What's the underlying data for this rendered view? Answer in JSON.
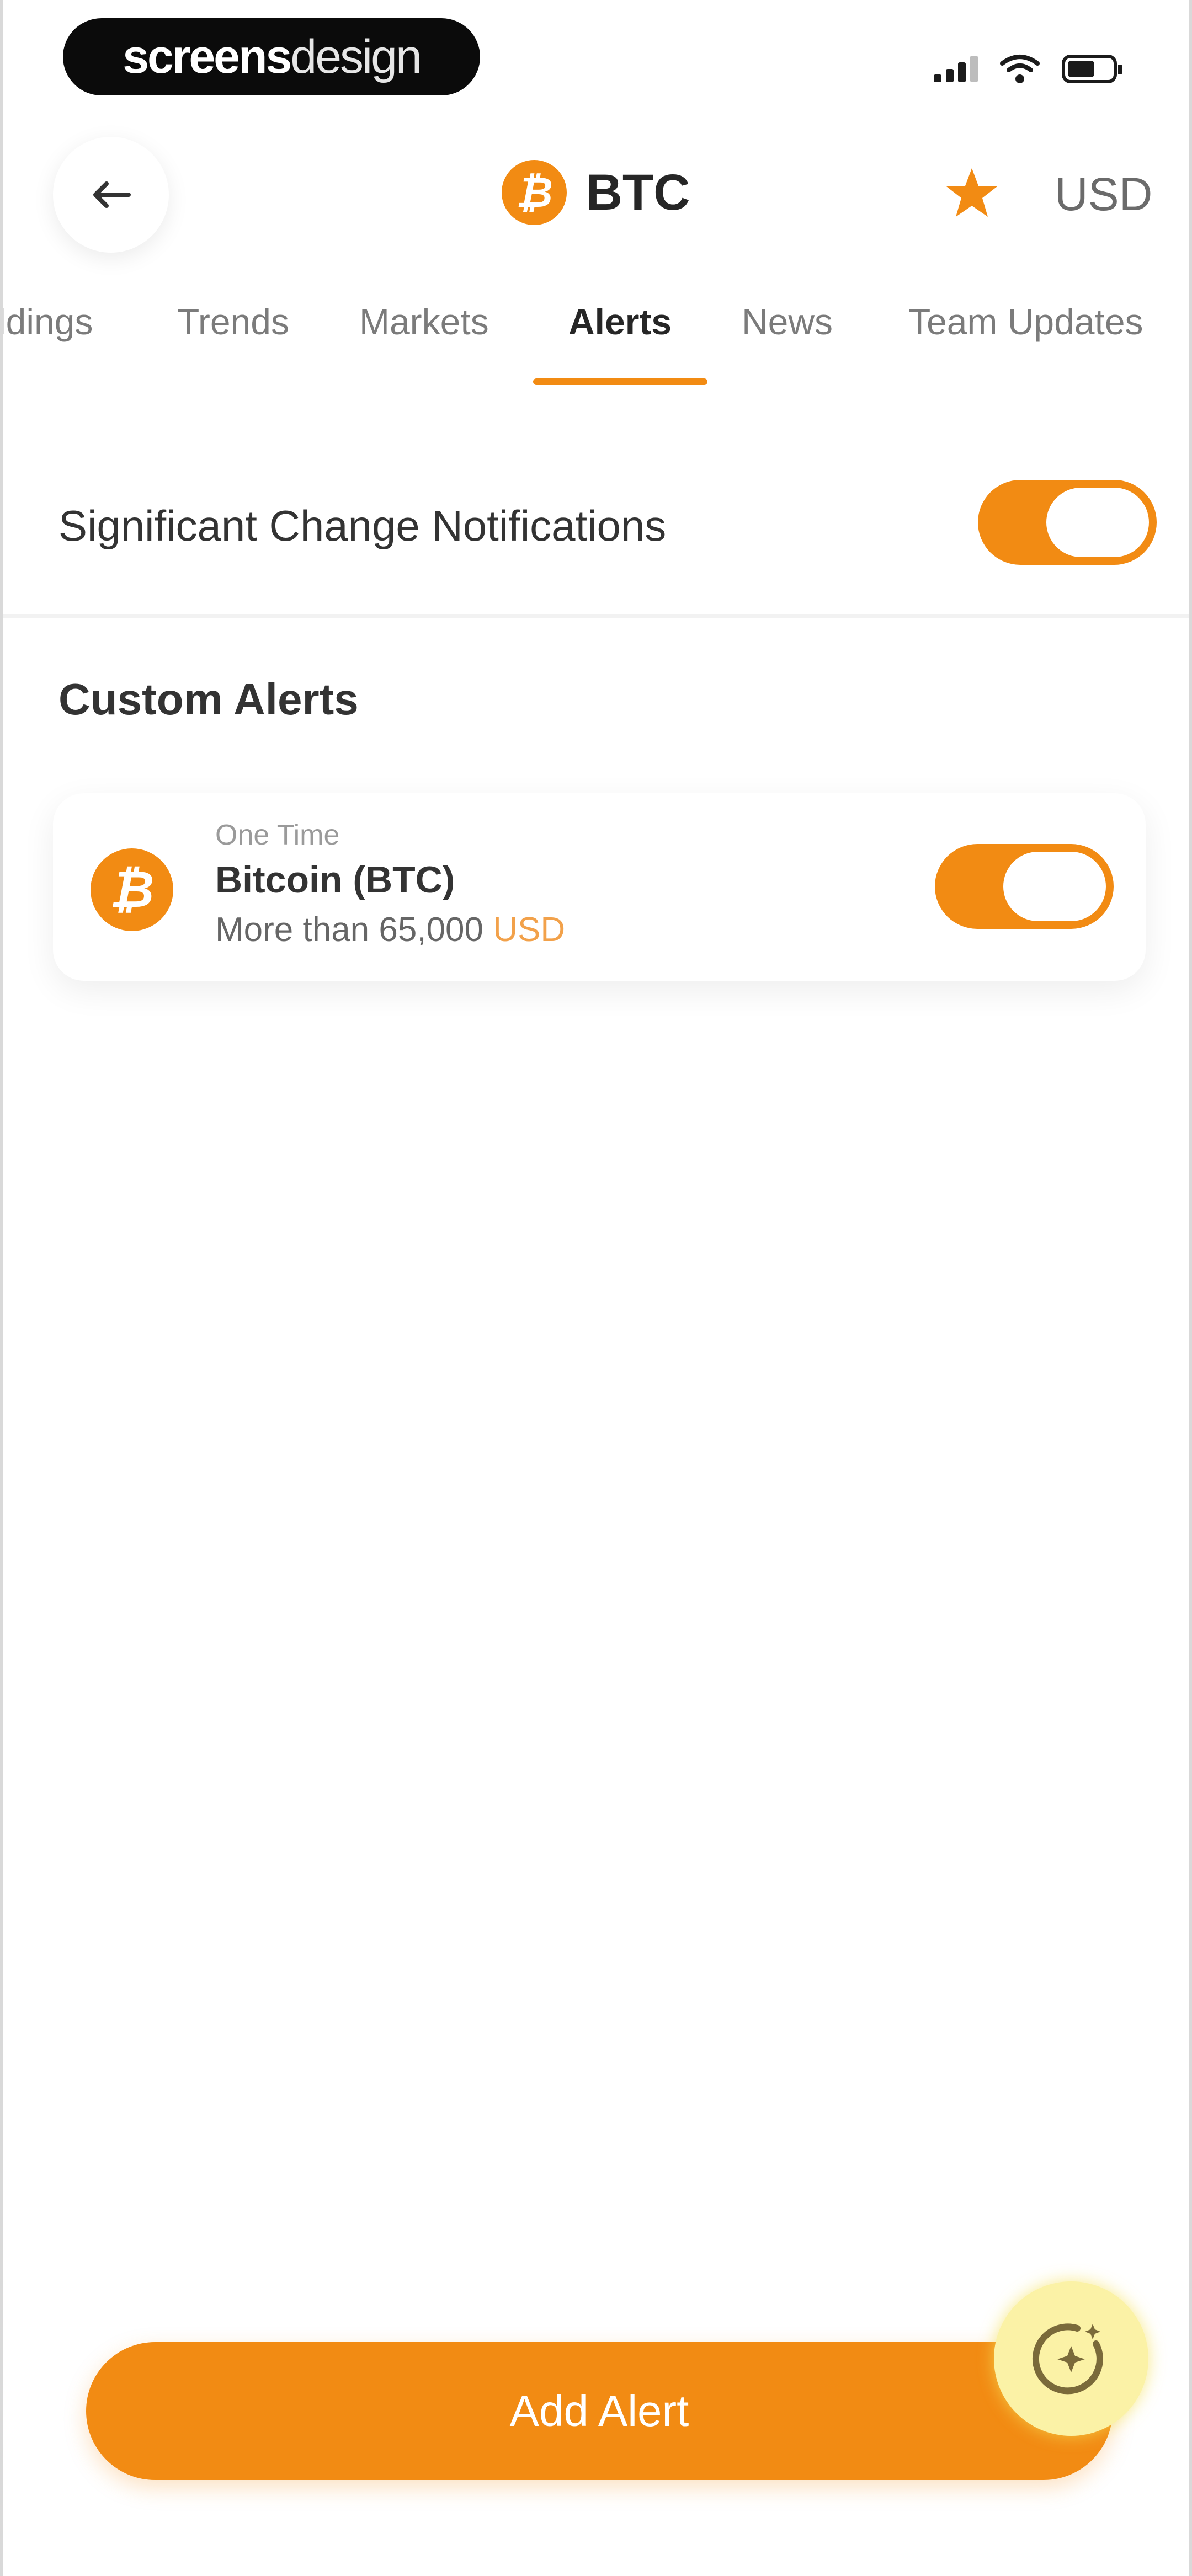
{
  "status_bar": {
    "brand_bold": "screens",
    "brand_light": "design"
  },
  "header": {
    "title": "BTC",
    "coin_symbol": "₿",
    "currency": "USD"
  },
  "tabs": [
    {
      "label": "Holdings",
      "visible_label": "ldings"
    },
    {
      "label": "Trends"
    },
    {
      "label": "Markets"
    },
    {
      "label": "Alerts",
      "active": true
    },
    {
      "label": "News"
    },
    {
      "label": "Team Updates"
    }
  ],
  "significant_change": {
    "label": "Significant Change Notifications",
    "enabled": true
  },
  "custom_alerts": {
    "title": "Custom Alerts",
    "items": [
      {
        "frequency": "One Time",
        "name": "Bitcoin (BTC)",
        "condition_text": "More than 65,000",
        "unit": "USD",
        "coin_symbol": "₿",
        "enabled": true
      }
    ]
  },
  "actions": {
    "add_alert_label": "Add Alert"
  },
  "colors": {
    "accent": "#f28b13",
    "assistant": "#fbf2a6"
  },
  "icons": {
    "back": "arrow-left-icon",
    "favorite": "star-icon",
    "assistant": "sparkle-assistant-icon",
    "signal": "signal-icon",
    "wifi": "wifi-icon",
    "battery": "battery-icon"
  }
}
